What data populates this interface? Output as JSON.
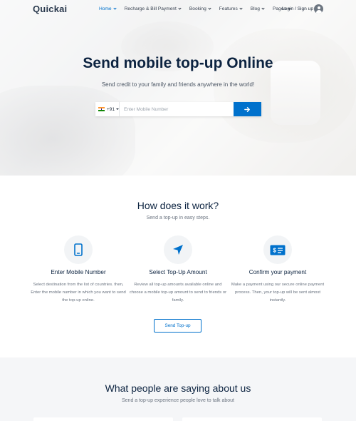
{
  "brand": {
    "logo": "Quickai",
    "accent": "#0071cc",
    "dark": "#0c2340"
  },
  "nav": {
    "items": [
      {
        "label": "Home",
        "active": true,
        "dropdown": true
      },
      {
        "label": "Recharge & Bill Payment",
        "active": false,
        "dropdown": true
      },
      {
        "label": "Booking",
        "active": false,
        "dropdown": true
      },
      {
        "label": "Features",
        "active": false,
        "dropdown": true
      },
      {
        "label": "Blog",
        "active": false,
        "dropdown": true
      },
      {
        "label": "Pages",
        "active": false,
        "dropdown": true
      }
    ],
    "login_label": "Login / Sign up",
    "avatar_icon": "user-icon"
  },
  "hero": {
    "title": "Send mobile top-up Online",
    "subtitle": "Send credit to your family and friends anywhere in the world!",
    "country_code": "+91",
    "country_flag": "india-flag-icon",
    "mobile_placeholder": "Enter Mobile Number",
    "submit_icon": "arrow-right-icon"
  },
  "how": {
    "title": "How does it work?",
    "subtitle": "Send a top-up in easy steps.",
    "steps": [
      {
        "icon": "mobile-phone-icon",
        "title": "Enter Mobile Number",
        "description": "Select destination from the list of countries. then, Enter the mobile number in which you want to send the top-up online."
      },
      {
        "icon": "location-arrow-icon",
        "title": "Select Top-Up Amount",
        "description": "Review all top-up amounts available online and choose a mobile top-up amount to send to friends or family."
      },
      {
        "icon": "payment-card-icon",
        "title": "Confirm your payment",
        "description": "Make a payment using our secure online payment process. Then, your top-up will be sent almost instantly."
      }
    ],
    "cta_label": "Send Top-up"
  },
  "testimonials": {
    "title": "What people are saying about us",
    "subtitle": "Send a top-up experience people love to talk about"
  }
}
